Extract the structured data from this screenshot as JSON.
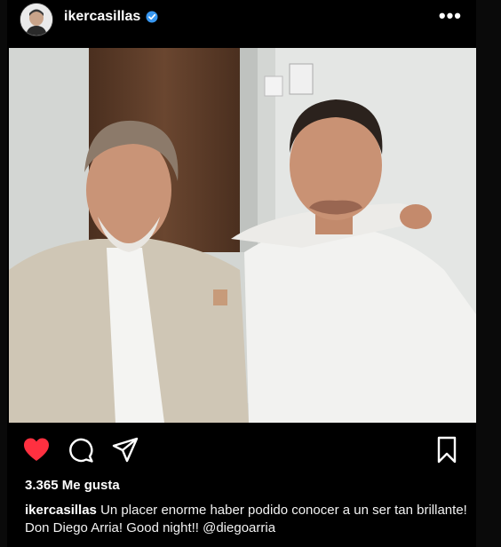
{
  "header": {
    "username": "ikercasillas",
    "more_label": "•••",
    "icons": {
      "verified": "verified-badge-icon",
      "more": "more-options-icon",
      "avatar": "profile-avatar"
    }
  },
  "photo": {
    "alt_subject": "photo"
  },
  "actions": {
    "icons": [
      "heart-filled-icon",
      "comment-icon",
      "share-icon",
      "bookmark-icon"
    ],
    "like_color": "#ff3040"
  },
  "likes": {
    "text": "3.365 Me gusta"
  },
  "caption": {
    "username": "ikercasillas",
    "text": "Un placer enorme haber podido conocer a un ser tan brillante! Don Diego Arria! Good night!! @diegoarria"
  },
  "colors": {
    "background": "#000000",
    "text": "#f5f5f5",
    "verified": "#3897f0"
  }
}
